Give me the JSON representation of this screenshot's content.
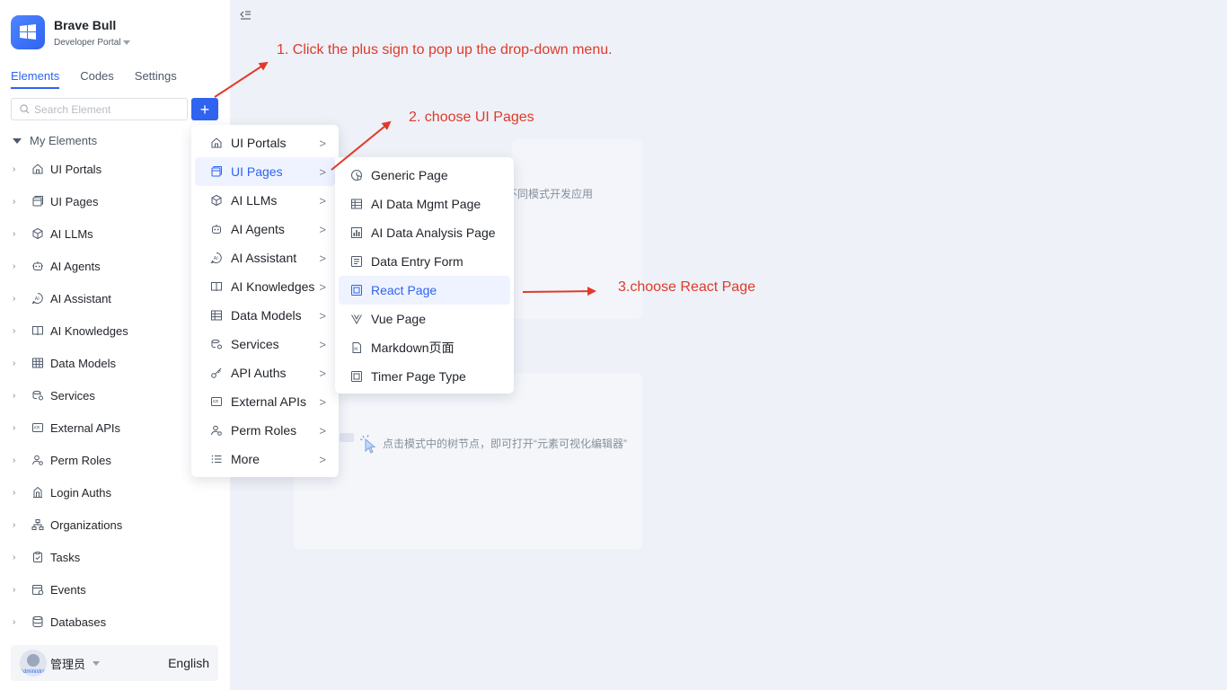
{
  "brand": {
    "name": "Brave Bull",
    "portal": "Developer Portal"
  },
  "tabs": [
    {
      "label": "Elements",
      "active": true
    },
    {
      "label": "Codes",
      "active": false
    },
    {
      "label": "Settings",
      "active": false
    }
  ],
  "search": {
    "placeholder": "Search Element",
    "value": ""
  },
  "add_button": {
    "label": "+"
  },
  "tree_section": {
    "label": "My Elements"
  },
  "tree": [
    {
      "label": "UI Portals",
      "icon": "home-icon"
    },
    {
      "label": "UI Pages",
      "icon": "pages-icon"
    },
    {
      "label": "AI LLMs",
      "icon": "cube-icon"
    },
    {
      "label": "AI Agents",
      "icon": "robot-icon"
    },
    {
      "label": "AI Assistant",
      "icon": "ai-icon"
    },
    {
      "label": "AI Knowledges",
      "icon": "book-icon"
    },
    {
      "label": "Data Models",
      "icon": "table-icon"
    },
    {
      "label": "Services",
      "icon": "services-icon"
    },
    {
      "label": "External APIs",
      "icon": "api-icon"
    },
    {
      "label": "Perm Roles",
      "icon": "roles-icon"
    },
    {
      "label": "Login Auths",
      "icon": "building-icon"
    },
    {
      "label": "Organizations",
      "icon": "org-icon"
    },
    {
      "label": "Tasks",
      "icon": "task-icon"
    },
    {
      "label": "Events",
      "icon": "event-icon"
    },
    {
      "label": "Databases",
      "icon": "database-icon"
    }
  ],
  "user": {
    "name": "管理员",
    "role_tag": "Administrator",
    "language": "English"
  },
  "menu1": [
    {
      "label": "UI Portals",
      "icon": "home-icon",
      "active": false
    },
    {
      "label": "UI Pages",
      "icon": "pages-icon",
      "active": true
    },
    {
      "label": "AI LLMs",
      "icon": "cube-icon",
      "active": false
    },
    {
      "label": "AI Agents",
      "icon": "robot-icon",
      "active": false
    },
    {
      "label": "AI Assistant",
      "icon": "ai-icon",
      "active": false
    },
    {
      "label": "AI Knowledges",
      "icon": "book-icon",
      "active": false
    },
    {
      "label": "Data Models",
      "icon": "table-icon",
      "active": false
    },
    {
      "label": "Services",
      "icon": "services-icon",
      "active": false
    },
    {
      "label": "API Auths",
      "icon": "key-icon",
      "active": false
    },
    {
      "label": "External APIs",
      "icon": "api-icon",
      "active": false
    },
    {
      "label": "Perm Roles",
      "icon": "roles-icon",
      "active": false
    },
    {
      "label": "More",
      "icon": "list-icon",
      "active": false
    }
  ],
  "menu2": [
    {
      "label": "Generic Page",
      "icon": "generic-page-icon",
      "active": false
    },
    {
      "label": "AI Data Mgmt Page",
      "icon": "table-icon",
      "active": false
    },
    {
      "label": "AI Data Analysis Page",
      "icon": "bar-chart-icon",
      "active": false
    },
    {
      "label": "Data Entry Form",
      "icon": "form-icon",
      "active": false
    },
    {
      "label": "React Page",
      "icon": "react-icon",
      "active": true
    },
    {
      "label": "Vue Page",
      "icon": "vue-icon",
      "active": false
    },
    {
      "label": "Markdown页面",
      "icon": "markdown-icon",
      "active": false
    },
    {
      "label": "Timer Page Type",
      "icon": "timer-icon",
      "active": false
    }
  ],
  "background": {
    "card1_text": "不同模式开发应用",
    "card2_hint": "点击模式中的树节点，即可打开“元素可视化编辑器”"
  },
  "annotations": {
    "step1": "1. Click the plus sign to pop up the drop-down menu.",
    "step2": "2. choose UI Pages",
    "step3": "3.choose React Page",
    "color": "#e03a2a"
  },
  "colors": {
    "accent": "#2f63f0",
    "background": "#eef1f7",
    "annotation": "#e03a2a"
  }
}
